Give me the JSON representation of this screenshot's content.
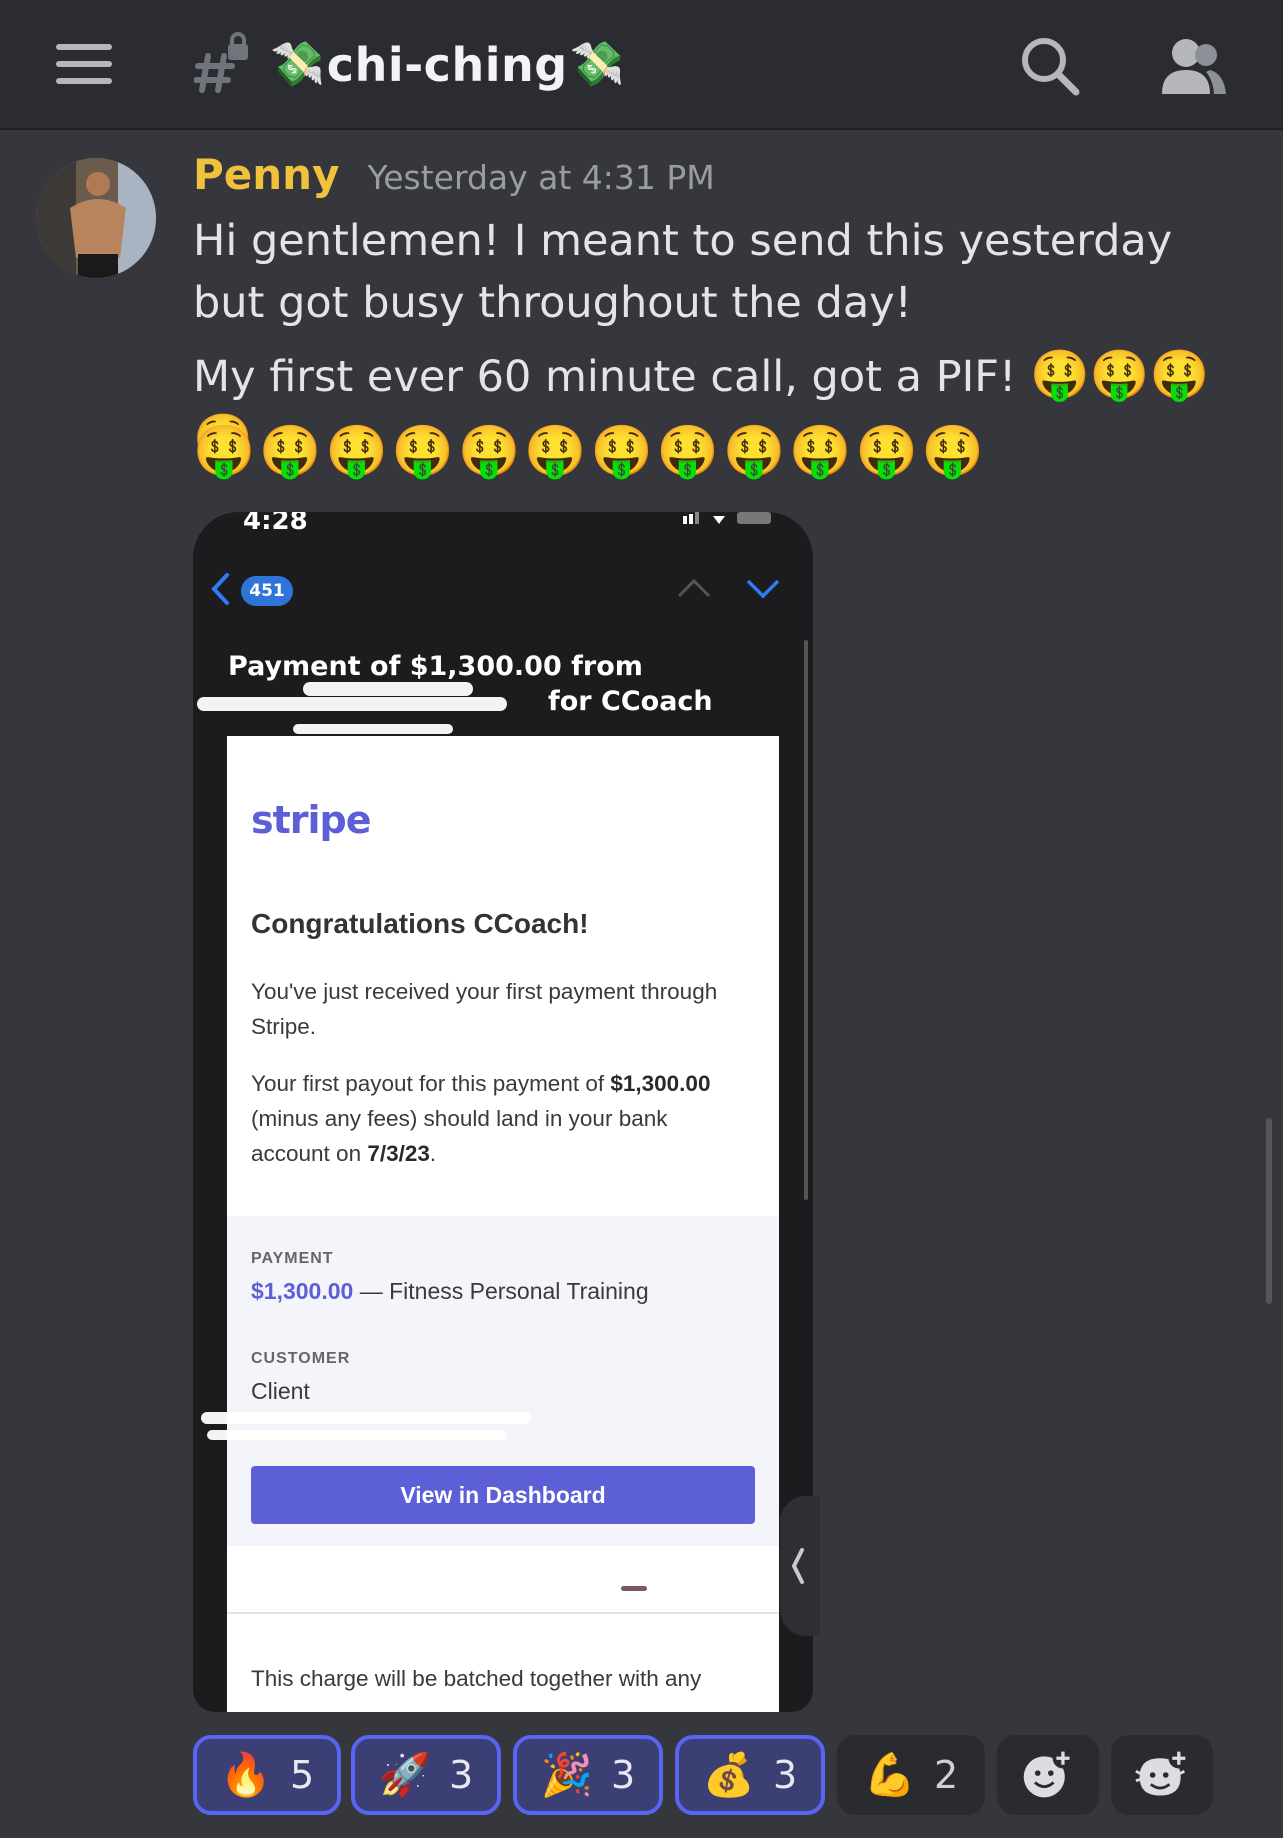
{
  "header": {
    "channel_name": "chi-ching",
    "channel_emoji": "💸",
    "icons": [
      "hamburger-icon",
      "locked-hash-icon",
      "search-icon",
      "members-icon"
    ]
  },
  "message": {
    "username": "Penny",
    "username_color": "#f0c23b",
    "timestamp": "Yesterday at 4:31 PM",
    "line1": "Hi gentlemen! I meant to send this yesterday but got busy throughout the day!",
    "line2": "My first ever 60 minute call, got a PIF!",
    "line2_emojis": "🤑🤑🤑🤑",
    "emoji_row": "🤑🤑🤑🤑🤑🤑🤑🤑🤑🤑🤑🤑"
  },
  "attachment": {
    "status_time": "4:28",
    "unread_badge": "451",
    "subject_line1": "Payment of $1,300.00 from",
    "subject_line2": "for CCoach",
    "email": {
      "logo": "stripe",
      "heading": "Congratulations CCoach!",
      "para1": "You've just received your first payment through Stripe.",
      "para2_prefix": "Your first payout for this payment of ",
      "para2_amount": "$1,300.00",
      "para2_middle": " (minus any fees) should land in your bank account on ",
      "para2_date": "7/3/23",
      "para2_suffix": ".",
      "payment_label": "PAYMENT",
      "payment_amount": "$1,300.00",
      "payment_desc": " — Fitness Personal Training",
      "customer_label": "CUSTOMER",
      "customer_value": "Client",
      "button_label": "View in Dashboard",
      "footer": "This charge will be batched together with any"
    }
  },
  "reactions": [
    {
      "emoji": "🔥",
      "count": "5",
      "active": true
    },
    {
      "emoji": "🚀",
      "count": "3",
      "active": true
    },
    {
      "emoji": "🎉",
      "count": "3",
      "active": true
    },
    {
      "emoji": "💰",
      "count": "3",
      "active": true
    },
    {
      "emoji": "💪",
      "count": "2",
      "active": false
    },
    {
      "emoji": "add-reaction-icon",
      "count": "",
      "active": false
    },
    {
      "emoji": "add-super-reaction-icon",
      "count": "",
      "active": false
    }
  ],
  "colors": {
    "background": "#36373d",
    "topbar": "#2b2c31",
    "accent": "#5865f2",
    "stripe": "#5c5fd6"
  }
}
